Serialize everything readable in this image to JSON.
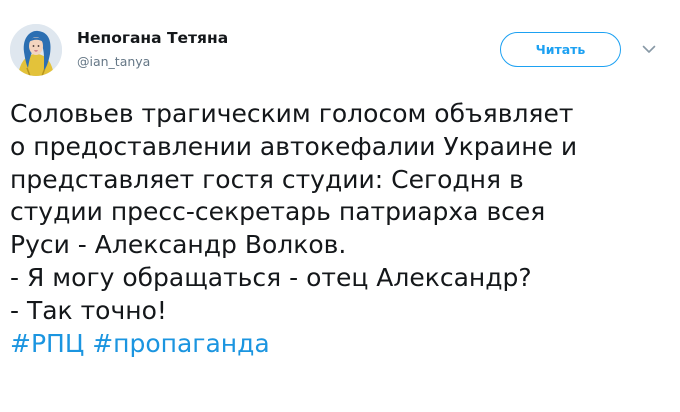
{
  "author": {
    "display_name": "Непогана Тетяна",
    "handle": "@ian_tanya",
    "avatar_icon": "avatar-illustration"
  },
  "follow_button": {
    "label": "Читать",
    "color": "#1da1f2"
  },
  "more_menu_icon": "chevron-down-icon",
  "tweet": {
    "lines": [
      "Соловьев трагическим голосом объявляет",
      "о предоставлении автокефалии Украине и",
      "представляет гостя студии: Сегодня в",
      "студии пресс-секретарь патриарха всея",
      "Руси - Александр Волков.",
      "- Я могу обращаться - отец Александр?",
      "- Так точно!"
    ],
    "hashtags": [
      "#РПЦ",
      "#пропаганда"
    ],
    "hashtag_color": "#1b95e0"
  }
}
